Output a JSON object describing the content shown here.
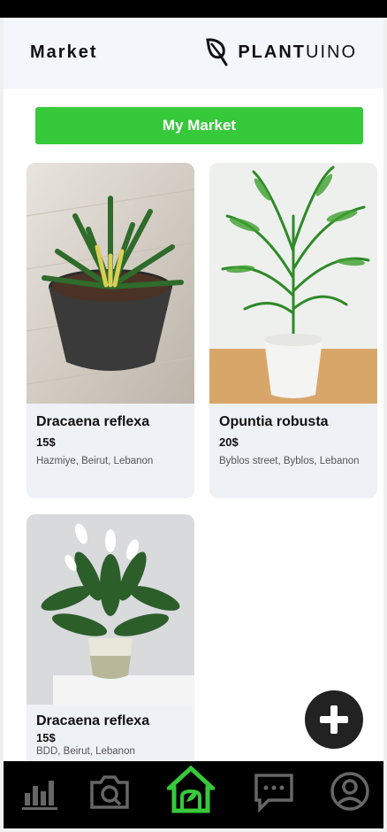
{
  "header": {
    "title": "Market",
    "brand_bold": "PLANT",
    "brand_light": "UINO"
  },
  "market_button_label": "My Market",
  "listings": [
    {
      "name": "Dracaena reflexa",
      "price": "15$",
      "location": "Hazmiye, Beirut, Lebanon"
    },
    {
      "name": "Opuntia robusta",
      "price": "20$",
      "location": "Byblos street, Byblos, Lebanon"
    },
    {
      "name": "Dracaena reflexa",
      "price": "15$",
      "location": "BDD, Beirut, Lebanon"
    }
  ],
  "nav": {
    "items": [
      "bar-chart-icon",
      "camera-icon",
      "home-icon",
      "chat-icon",
      "profile-icon"
    ],
    "active": "home-icon",
    "active_color": "#36c93a",
    "icon_color": "#666666"
  },
  "colors": {
    "accent": "#36c93a",
    "card_bg": "#eef1f6",
    "header_bg": "#f3f6fb"
  }
}
